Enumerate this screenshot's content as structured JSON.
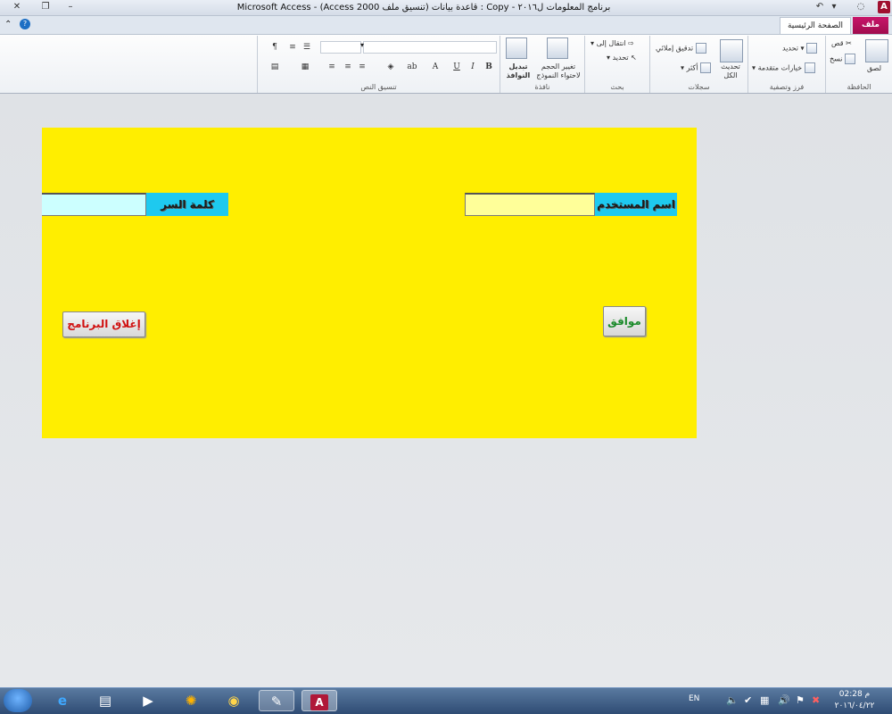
{
  "window": {
    "title": "برنامج المعلومات ل٢٠١٦ - Copy : قاعدة بيانات (تنسيق ملف Access 2000) - Microsoft Access",
    "app_icon": "A",
    "controls": {
      "minimize": "–",
      "restore": "❐",
      "close": "✕"
    }
  },
  "tabs": {
    "file": "ملف",
    "home": "الصفحة الرئيسية"
  },
  "ribbon": {
    "clipboard": {
      "label": "الحافظة",
      "paste": "لصق",
      "cut": "قص",
      "copy": "نسخ"
    },
    "sort_filter": {
      "label": "فرز وتصفية",
      "selection": "تحديد",
      "advanced": "خيارات متقدمة"
    },
    "records": {
      "label": "سجلات",
      "refresh_all": "تحديث الكل",
      "spelling": "تدقيق إملائي",
      "more": "أكثر"
    },
    "find": {
      "label": "بحث",
      "goto": "انتقال إلى",
      "select": "تحديد"
    },
    "window": {
      "label": "نافذة",
      "size_to_fit": "تغيير الحجم لاحتواء النموذج",
      "switch_windows": "تبديل النوافذ"
    },
    "text_formatting": {
      "label": "تنسيق النص"
    }
  },
  "form": {
    "username_label": "اسم المستخدم",
    "username_value": "",
    "password_label": "كلمة السر",
    "password_value": "",
    "ok_button": "موافق",
    "exit_button": "إغلاق البرنامج"
  },
  "colors": {
    "form_bg": "#ffee00",
    "label_bg": "#1ec9ef",
    "username_field_bg": "#ffff99",
    "password_field_bg": "#ccffff",
    "ok_text": "#1a8a2a",
    "exit_text": "#d01010"
  },
  "taskbar": {
    "language": "EN",
    "time": "02:28 م",
    "date": "٢٠١٦/٠٤/٢٢"
  }
}
